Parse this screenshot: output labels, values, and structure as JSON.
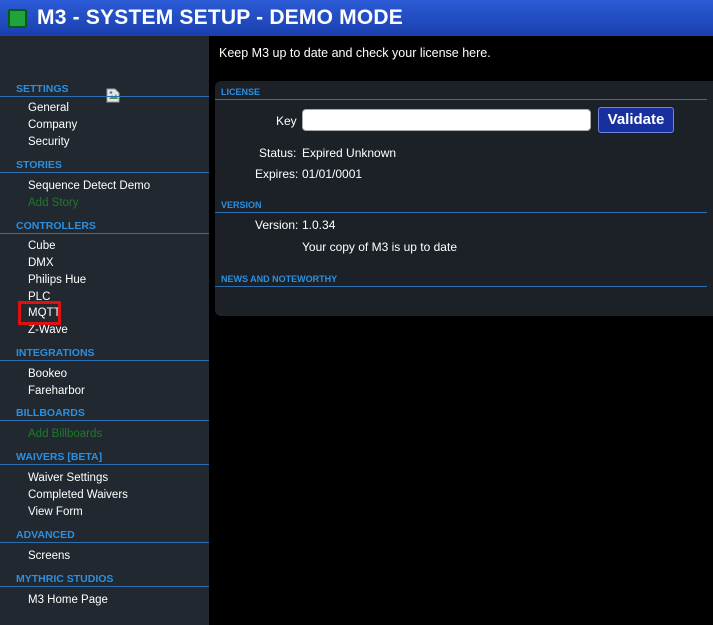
{
  "window": {
    "title": "M3 - SYSTEM SETUP - DEMO MODE"
  },
  "sidebar": {
    "sections": [
      {
        "header": "SETTINGS",
        "items": [
          "General",
          "Company",
          "Security"
        ]
      },
      {
        "header": "STORIES",
        "items": [
          "Sequence Detect Demo",
          "Add Story"
        ]
      },
      {
        "header": "CONTROLLERS",
        "items": [
          "Cube",
          "DMX",
          "Philips Hue",
          "PLC",
          "MQTT",
          "Z-Wave"
        ]
      },
      {
        "header": "INTEGRATIONS",
        "items": [
          "Bookeo",
          "Fareharbor"
        ]
      },
      {
        "header": "BILLBOARDS",
        "items": [
          "Add Billboards"
        ]
      },
      {
        "header": "WAIVERS [BETA]",
        "items": [
          "Waiver Settings",
          "Completed Waivers",
          "View Form"
        ]
      },
      {
        "header": "ADVANCED",
        "items": [
          "Screens"
        ]
      },
      {
        "header": "MYTHRIC STUDIOS",
        "items": [
          "M3 Home Page"
        ]
      }
    ]
  },
  "main": {
    "intro": "Keep M3 up to date and check your license here.",
    "license": {
      "header": "LICENSE",
      "key_label": "Key",
      "key_value": "",
      "validate_label": "Validate",
      "status_label": "Status:",
      "status_value": "Expired Unknown",
      "expires_label": "Expires:",
      "expires_value": "01/01/0001"
    },
    "version": {
      "header": "VERSION",
      "version_label": "Version:",
      "version_value": "1.0.34",
      "message": "Your copy of M3 is up to date"
    },
    "news": {
      "header": "NEWS AND NOTEWORTHY"
    }
  },
  "colors": {
    "title_bar": "#1a3fae",
    "section_header": "#2c8fe0",
    "sidebar_bg": "#22282f",
    "disabled_item": "#1f7a2b",
    "highlight_box": "#e01010",
    "validate_button": "#1a2f9e"
  }
}
